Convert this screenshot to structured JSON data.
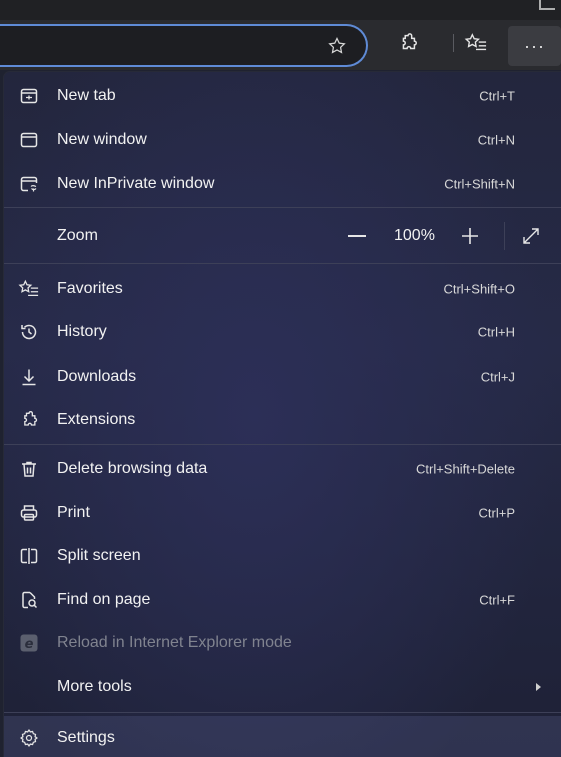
{
  "toolbar": {
    "favorite_icon": "star-outline-icon",
    "extensions_icon": "puzzle-icon",
    "favorites_icon": "favorites-list-icon",
    "more_label": "···"
  },
  "menu": {
    "items": [
      {
        "label": "New tab",
        "shortcut": "Ctrl+T",
        "icon": "new-tab-icon"
      },
      {
        "label": "New window",
        "shortcut": "Ctrl+N",
        "icon": "new-window-icon"
      },
      {
        "label": "New InPrivate window",
        "shortcut": "Ctrl+Shift+N",
        "icon": "inprivate-icon"
      },
      {
        "label": "Zoom",
        "value": "100%",
        "icon": ""
      },
      {
        "label": "Favorites",
        "shortcut": "Ctrl+Shift+O",
        "icon": "favorites-icon"
      },
      {
        "label": "History",
        "shortcut": "Ctrl+H",
        "icon": "history-icon"
      },
      {
        "label": "Downloads",
        "shortcut": "Ctrl+J",
        "icon": "download-icon"
      },
      {
        "label": "Extensions",
        "shortcut": "",
        "icon": "puzzle-icon"
      },
      {
        "label": "Delete browsing data",
        "shortcut": "Ctrl+Shift+Delete",
        "icon": "trash-icon"
      },
      {
        "label": "Print",
        "shortcut": "Ctrl+P",
        "icon": "printer-icon"
      },
      {
        "label": "Split screen",
        "shortcut": "",
        "icon": "split-screen-icon"
      },
      {
        "label": "Find on page",
        "shortcut": "Ctrl+F",
        "icon": "find-icon"
      },
      {
        "label": "Reload in Internet Explorer mode",
        "shortcut": "",
        "icon": "ie-icon",
        "disabled": true
      },
      {
        "label": "More tools",
        "shortcut": "",
        "icon": ""
      },
      {
        "label": "Settings",
        "shortcut": "",
        "icon": "gear-icon"
      }
    ]
  }
}
